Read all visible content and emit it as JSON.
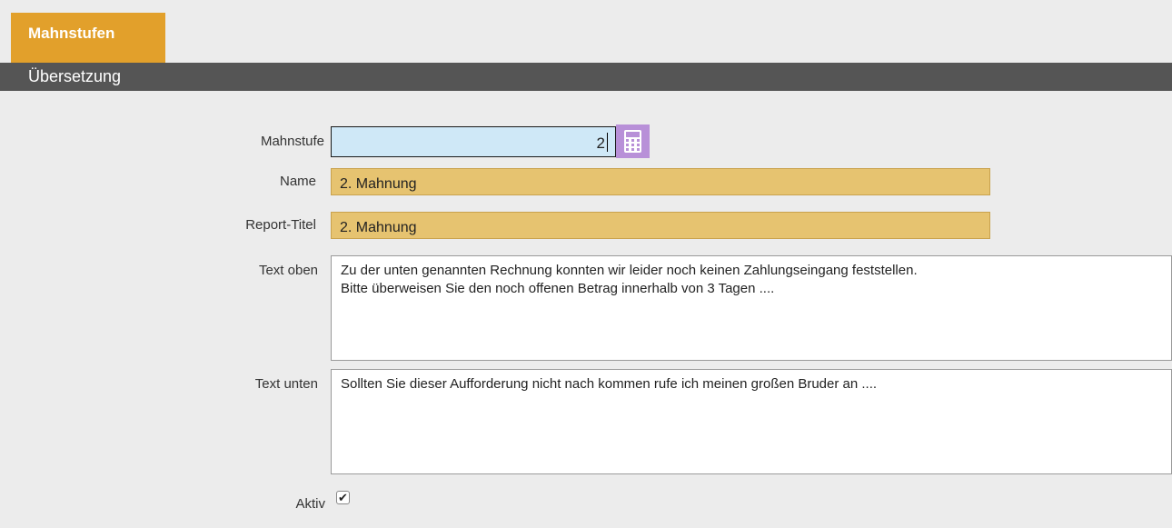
{
  "tabs": {
    "active_label": "Mahnstufen"
  },
  "section": {
    "title": "Übersetzung"
  },
  "form": {
    "mahnstufe": {
      "label": "Mahnstufe",
      "value": "2",
      "icon": "calculator-icon"
    },
    "name": {
      "label": "Name",
      "value": "2. Mahnung"
    },
    "report_titel": {
      "label": "Report-Titel",
      "value": "2. Mahnung"
    },
    "text_oben": {
      "label": "Text oben",
      "value": "Zu der unten genannten Rechnung konnten wir leider noch keinen Zahlungseingang feststellen.\nBitte überweisen Sie den noch offenen Betrag innerhalb von 3 Tagen ...."
    },
    "text_unten": {
      "label": "Text unten",
      "value": "Sollten Sie dieser Aufforderung nicht nach kommen rufe ich meinen großen Bruder an ...."
    },
    "aktiv": {
      "label": "Aktiv",
      "checked": true
    }
  },
  "colors": {
    "tab_active": "#e2a02b",
    "section_bar": "#555555",
    "number_field": "#cfe8f7",
    "required_field": "#e6c370",
    "calculator_button": "#b890d8"
  }
}
